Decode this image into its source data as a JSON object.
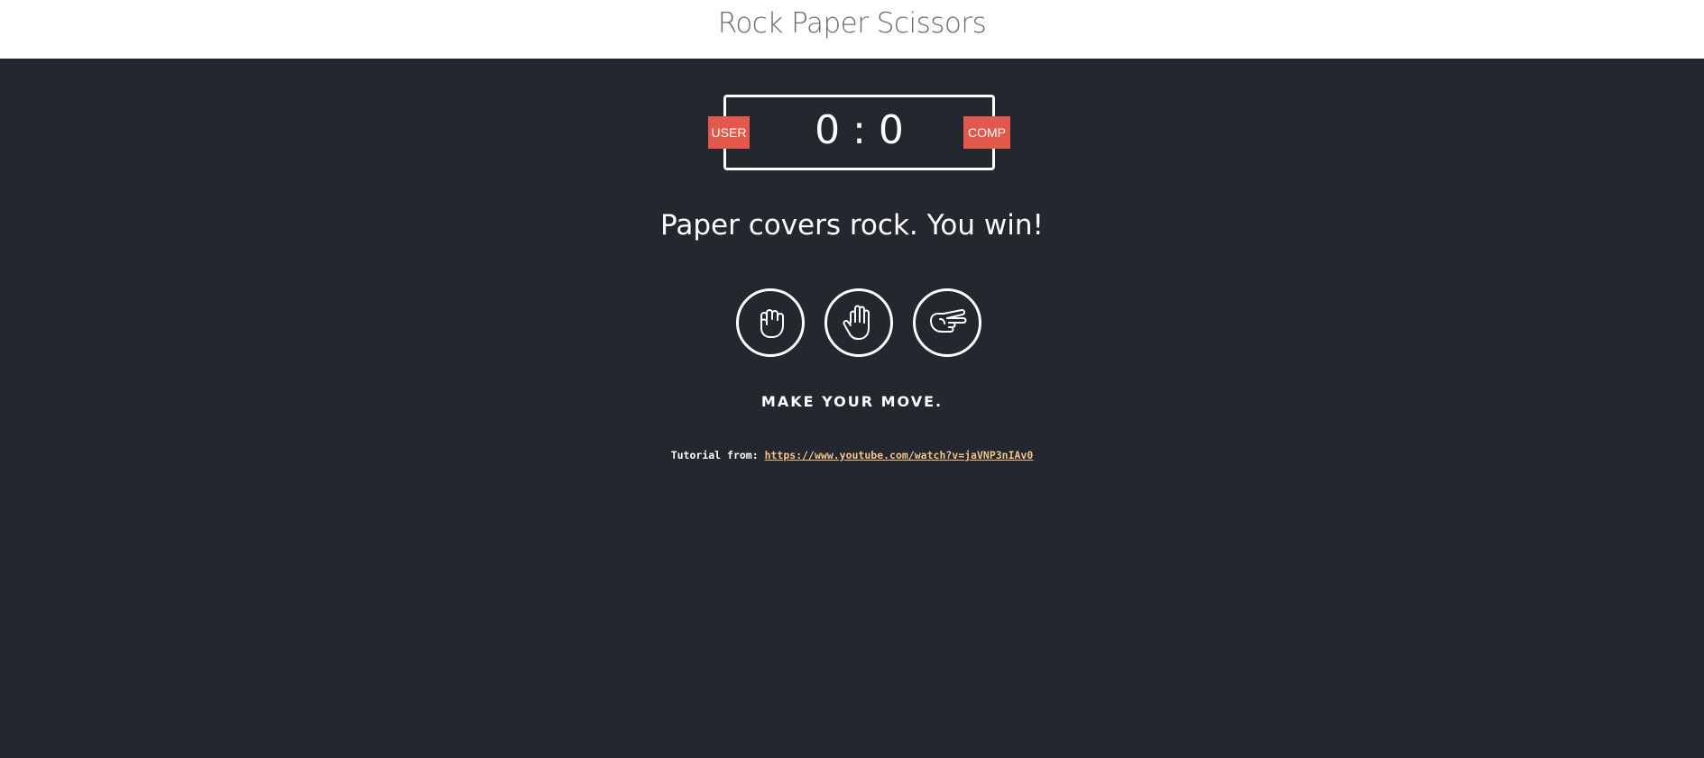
{
  "header": {
    "title": "Rock Paper Scissors"
  },
  "scoreboard": {
    "user_label": "USER",
    "comp_label": "COMP",
    "user_score": "0",
    "separator": ":",
    "comp_score": "0"
  },
  "result": {
    "message": "Paper covers rock. You win!"
  },
  "choices": [
    {
      "name": "rock",
      "icon": "rock-hand-icon"
    },
    {
      "name": "paper",
      "icon": "paper-hand-icon"
    },
    {
      "name": "scissors",
      "icon": "scissors-hand-icon"
    }
  ],
  "prompt": {
    "text": "MAKE YOUR MOVE."
  },
  "tutorial": {
    "label": "Tutorial from:",
    "link_text": "https://www.youtube.com/watch?v=jaVNP3nIAv0"
  },
  "colors": {
    "background": "#24272e",
    "header_bg": "#ffffff",
    "badge": "#e2584d",
    "link": "#f3c38a"
  }
}
